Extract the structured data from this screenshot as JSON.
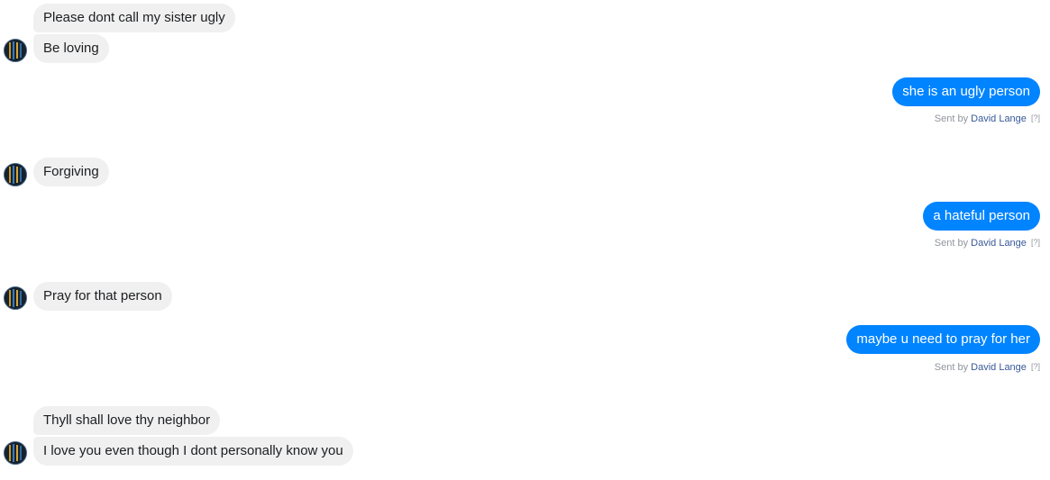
{
  "conversation": {
    "messages": [
      {
        "text": "Please dont call my sister ugly"
      },
      {
        "text": "Be loving"
      },
      {
        "text": "she is an ugly person"
      },
      {
        "text": "Forgiving"
      },
      {
        "text": "a hateful person"
      },
      {
        "text": "Pray for that person"
      },
      {
        "text": "maybe u need to pray for her"
      },
      {
        "text": "Thyll shall love thy neighbor"
      },
      {
        "text": "I love you even though I dont personally know you"
      }
    ],
    "sent_by": {
      "prefix": "Sent by",
      "name": "David Lange",
      "help": "[?]"
    }
  },
  "colors": {
    "outgoing_bubble": "#0084ff",
    "incoming_bubble": "#f0f0f0",
    "sender_link": "#385898"
  },
  "icons": {
    "avatar": "contact-avatar-icon"
  }
}
